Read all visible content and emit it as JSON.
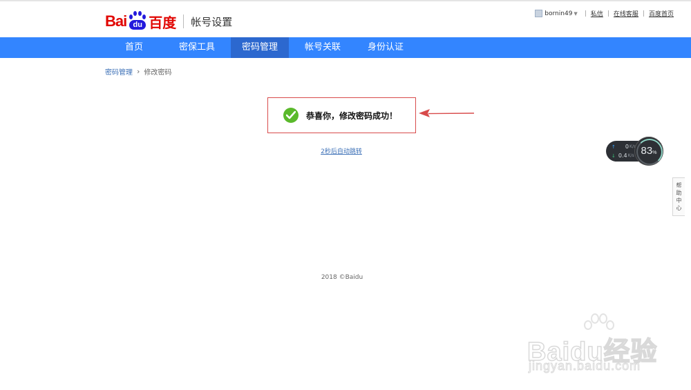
{
  "header": {
    "logo": {
      "bai": "Bai",
      "du": "du",
      "cn": "百度"
    },
    "section_title": "帐号设置"
  },
  "userbar": {
    "username": "bornin49",
    "links": [
      "私信",
      "在线客服",
      "百度首页"
    ]
  },
  "nav": {
    "items": [
      {
        "label": "首页",
        "active": false
      },
      {
        "label": "密保工具",
        "active": false
      },
      {
        "label": "密码管理",
        "active": true
      },
      {
        "label": "帐号关联",
        "active": false
      },
      {
        "label": "身份认证",
        "active": false
      }
    ]
  },
  "breadcrumb": {
    "parent": "密码管理",
    "current": "修改密码"
  },
  "message": {
    "text": "恭喜你，修改密码成功！",
    "icon": "check-circle-icon"
  },
  "redirect": {
    "text": "2秒后自动跳转"
  },
  "speed_widget": {
    "upload": "0",
    "download": "0.4",
    "unit": "K/s",
    "percent": "83",
    "percent_sign": "%"
  },
  "help_tab": {
    "label": "帮助中心"
  },
  "footer": {
    "copyright": "2018 ©Baidu"
  },
  "watermark": {
    "text": "Baidu经验",
    "url": "jingyan.baidu.com"
  },
  "colors": {
    "nav_bg": "#3385ff",
    "nav_active": "#2c68cf",
    "brand_red": "#e10602",
    "brand_blue": "#2319dc",
    "success_green": "#5ab92b",
    "annotation_red": "#d84a4a"
  }
}
